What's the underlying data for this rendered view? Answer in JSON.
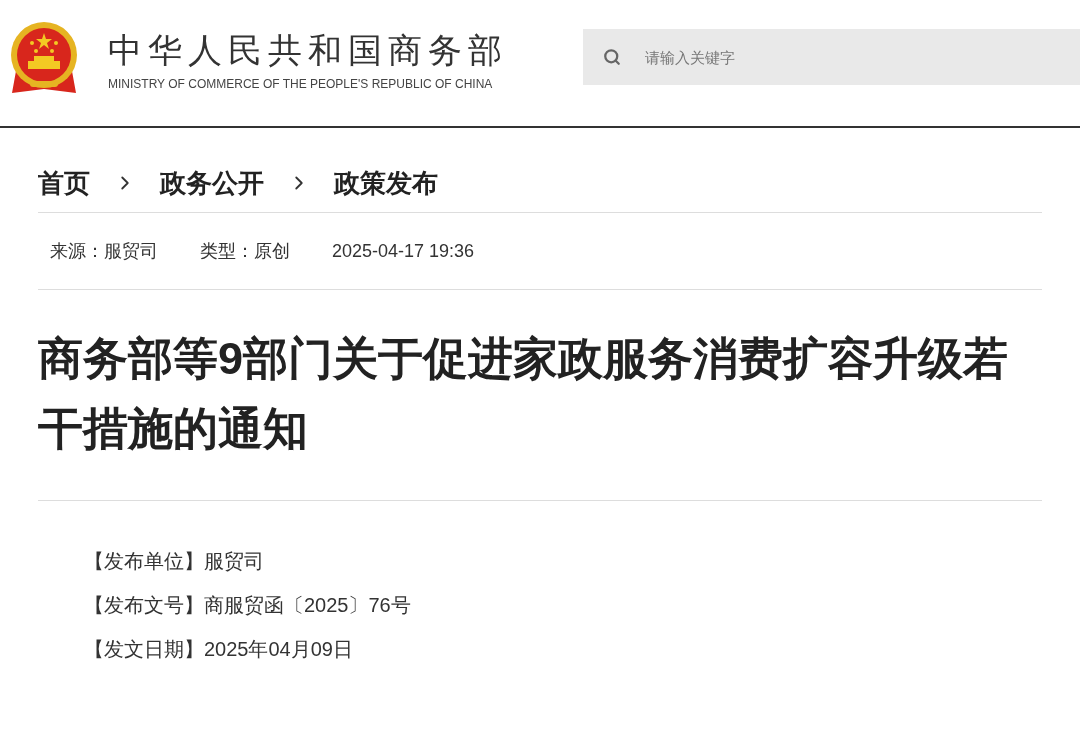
{
  "header": {
    "title_cn": "中华人民共和国商务部",
    "title_en": "MINISTRY OF COMMERCE OF THE PEOPLE'S REPUBLIC OF CHINA",
    "search": {
      "placeholder": "请输入关键字"
    }
  },
  "breadcrumb": [
    "首页",
    "政务公开",
    "政策发布"
  ],
  "meta": [
    "来源：服贸司",
    "类型：原创",
    "2025-04-17 19:36"
  ],
  "article": {
    "title": "商务部等9部门关于促进家政服务消费扩容升级若干措施的通知",
    "info": [
      "【发布单位】服贸司",
      "【发布文号】商服贸函〔2025〕76号",
      "【发文日期】2025年04月09日"
    ]
  }
}
